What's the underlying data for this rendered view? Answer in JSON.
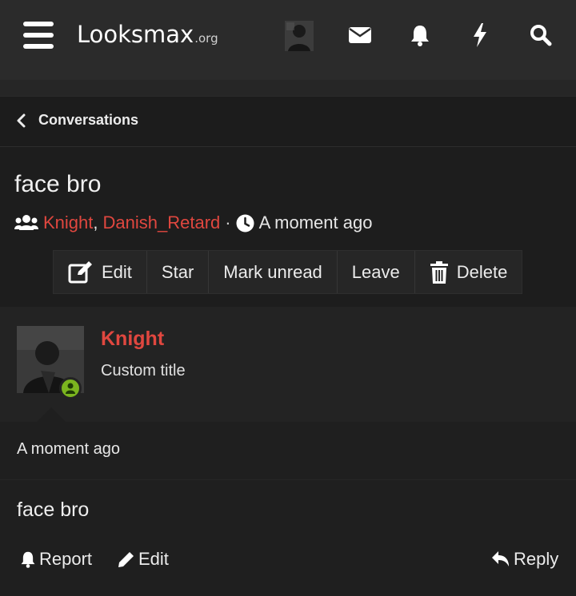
{
  "header": {
    "logo_main": "Looksmax",
    "logo_tld": ".org",
    "icons": [
      "menu-icon",
      "envelope-icon",
      "bell-icon",
      "bolt-icon",
      "search-icon"
    ]
  },
  "breadcrumb": {
    "label": "Conversations",
    "icon": "chevron-left-icon"
  },
  "conversation": {
    "title": "face bro",
    "participants": [
      "Knight",
      "Danish_Retard"
    ],
    "participant_comma": ",",
    "meta_separator": "·",
    "time": "A moment ago",
    "icons": [
      "users-icon",
      "clock-icon"
    ]
  },
  "toolbar": {
    "edit_label": "Edit",
    "star_label": "Star",
    "mark_unread_label": "Mark unread",
    "leave_label": "Leave",
    "delete_label": "Delete"
  },
  "message": {
    "author": "Knight",
    "user_title": "Custom title",
    "time": "A moment ago",
    "text": "face bro",
    "actions": {
      "report_label": "Report",
      "edit_label": "Edit",
      "reply_label": "Reply"
    }
  },
  "colors": {
    "accent_red": "#e0473f",
    "online_green": "#7bb51f",
    "header_bg": "#2b2b2b",
    "page_bg": "#1f1f1f"
  }
}
